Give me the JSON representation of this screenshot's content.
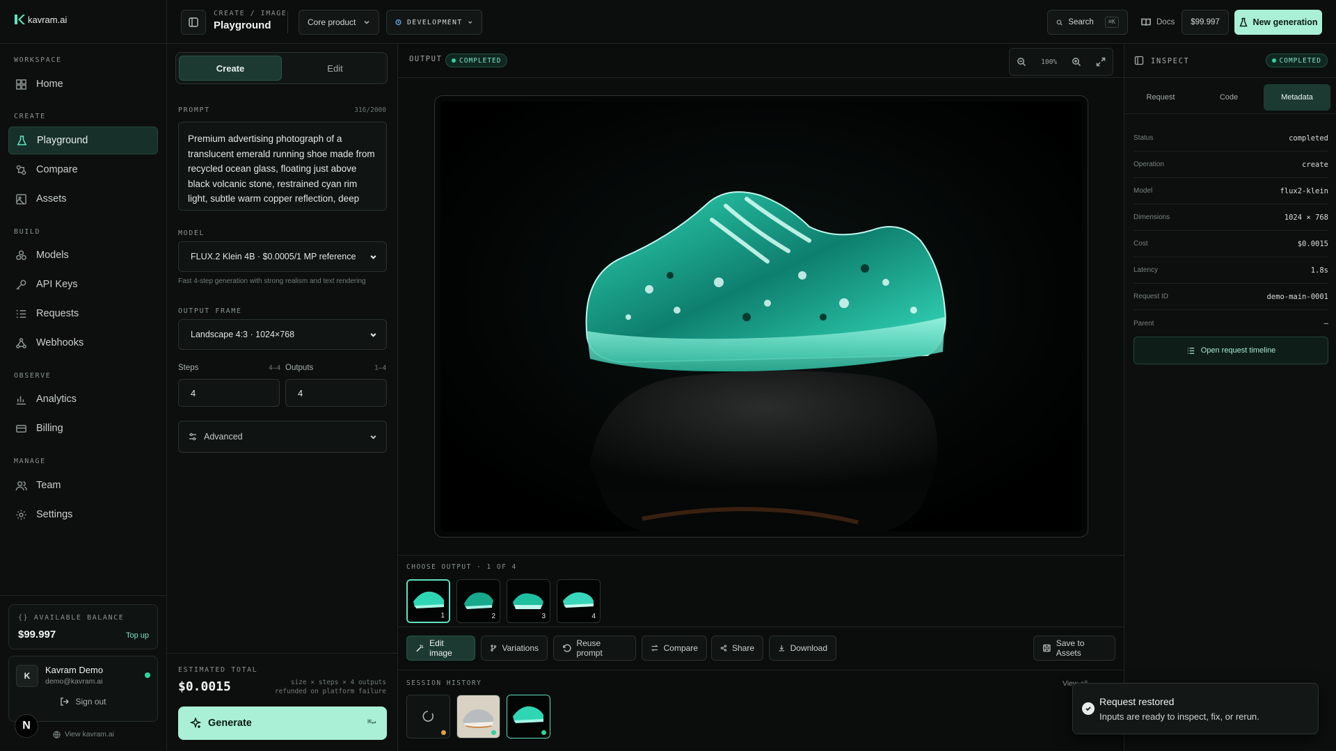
{
  "brand": {
    "name": "kavram.ai"
  },
  "sidebar": {
    "sections": [
      {
        "label": "WORKSPACE",
        "items": [
          {
            "label": "Home",
            "icon": "grid-icon"
          }
        ]
      },
      {
        "label": "CREATE",
        "items": [
          {
            "label": "Playground",
            "icon": "flask-icon",
            "active": true
          },
          {
            "label": "Compare",
            "icon": "compare-icon"
          },
          {
            "label": "Assets",
            "icon": "image-icon"
          }
        ]
      },
      {
        "label": "BUILD",
        "items": [
          {
            "label": "Models",
            "icon": "models-icon"
          },
          {
            "label": "API Keys",
            "icon": "key-icon"
          },
          {
            "label": "Requests",
            "icon": "list-icon"
          },
          {
            "label": "Webhooks",
            "icon": "webhook-icon"
          }
        ]
      },
      {
        "label": "OBSERVE",
        "items": [
          {
            "label": "Analytics",
            "icon": "chart-icon"
          },
          {
            "label": "Billing",
            "icon": "card-icon"
          }
        ]
      },
      {
        "label": "MANAGE",
        "items": [
          {
            "label": "Team",
            "icon": "users-icon"
          },
          {
            "label": "Settings",
            "icon": "gear-icon"
          }
        ]
      }
    ],
    "balance": {
      "label": "{} AVAILABLE BALANCE",
      "value": "$99.997",
      "topup": "Top up"
    },
    "user": {
      "initial": "K",
      "name": "Kavram Demo",
      "email": "demo@kavram.ai",
      "signout": "Sign out"
    },
    "view_site": "View kavram.ai",
    "n_badge": "N"
  },
  "topbar": {
    "breadcrumb": "CREATE / IMAGE",
    "title": "Playground",
    "project": "Core product",
    "env": "DEVELOPMENT",
    "search": "Search",
    "search_kbd": "⌘K",
    "docs": "Docs",
    "balance": "$99.997",
    "new_generation": "New generation"
  },
  "left": {
    "tabs": [
      "Create",
      "Edit"
    ],
    "prompt_label": "PROMPT",
    "prompt_count": "316/2000",
    "prompt_text": "Premium advertising photograph of a translucent emerald running shoe made from recycled ocean glass, floating just above black volcanic stone, restrained cyan rim light, subtle warm copper reflection, deep black studio…",
    "model_label": "MODEL",
    "model_value": "FLUX.2 Klein 4B · $0.0005/1 MP reference",
    "model_hint": "Fast 4-step generation with strong realism and text rendering",
    "frame_label": "OUTPUT FRAME",
    "frame_value": "Landscape 4:3 · 1024×768",
    "steps_label": "Steps",
    "steps_range": "4–4",
    "steps_value": "4",
    "outputs_label": "Outputs",
    "outputs_range": "1–4",
    "outputs_value": "4",
    "advanced": "Advanced",
    "est_label": "ESTIMATED TOTAL",
    "est_value": "$0.0015",
    "est_note1": "size × steps × 4 outputs",
    "est_note2": "refunded on platform failure",
    "generate": "Generate",
    "generate_kbd": "⌘↵"
  },
  "center": {
    "output_label": "OUTPUT",
    "status": "COMPLETED",
    "zoom": "100%",
    "choose_label": "CHOOSE OUTPUT · 1 OF 4",
    "thumbs": [
      "1",
      "2",
      "3",
      "4"
    ],
    "actions": [
      "Edit image",
      "Variations",
      "Reuse prompt",
      "Compare",
      "Share",
      "Download"
    ],
    "save": "Save to Assets",
    "history_label": "SESSION HISTORY",
    "view_all": "View all →"
  },
  "inspect": {
    "label": "INSPECT",
    "status": "COMPLETED",
    "tabs": [
      "Request",
      "Code",
      "Metadata"
    ],
    "rows": [
      {
        "k": "Status",
        "v": "completed"
      },
      {
        "k": "Operation",
        "v": "create"
      },
      {
        "k": "Model",
        "v": "flux2-klein"
      },
      {
        "k": "Dimensions",
        "v": "1024 × 768"
      },
      {
        "k": "Cost",
        "v": "$0.0015"
      },
      {
        "k": "Latency",
        "v": "1.8s"
      },
      {
        "k": "Request ID",
        "v": "demo-main-0001"
      },
      {
        "k": "Parent",
        "v": "—"
      }
    ],
    "timeline": "Open request timeline"
  },
  "toast": {
    "title": "Request restored",
    "body": "Inputs are ready to inspect, fix, or rerun."
  },
  "colors": {
    "accent": "#a9f0d6",
    "active_bg": "#1c3a31",
    "status_green": "#2fd49c"
  }
}
